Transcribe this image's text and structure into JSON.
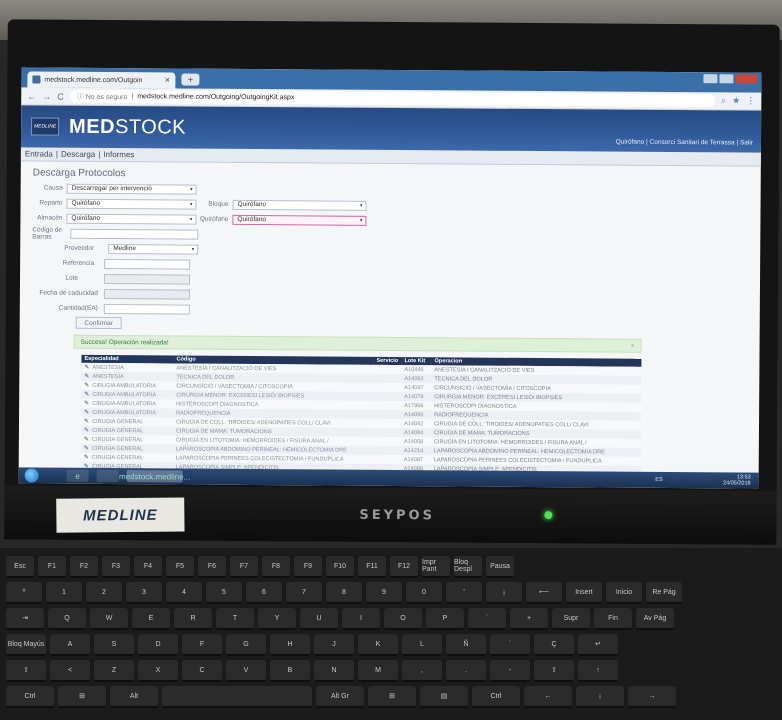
{
  "browser": {
    "tab_title": "medstock.medline.com/Outgoin",
    "tab_close": "✕",
    "new_tab": "+",
    "nav_back": "←",
    "nav_forward": "→",
    "nav_reload": "C",
    "url_warning": "ⓘ No es seguro",
    "url": "medstock.medline.com/Outgoing/OutgoingKit.aspx",
    "icon_search": "⌕",
    "icon_star": "★",
    "icon_menu": "⋮"
  },
  "app": {
    "badge": "MEDLINE",
    "title_bold": "MED",
    "title_rest": "STOCK",
    "user_info": "Quirófano | Consorci Sanitari de Terrassa | Salir"
  },
  "menu": {
    "items": [
      "Entrada",
      "Descarga",
      "Informes"
    ],
    "sep": "|"
  },
  "form": {
    "section_title": "Descarga Protocolos",
    "causa_label": "Causa",
    "causa_value": "Descarregar per intervenció",
    "reparto_label": "Reparto",
    "reparto_value": "Quirófano",
    "bloque_label": "Bloque",
    "bloque_value": "Quirófano",
    "almacen_label": "Almacén",
    "almacen_value": "Quirófano",
    "quirofano_label": "Quirófano",
    "quirofano_value": "Quirófano",
    "codigo_barras_label": "Código de Barras",
    "proveedor_label": "Proveedor",
    "proveedor_value": "Medline",
    "referencia_label": "Referencia",
    "lote_label": "Lote",
    "fecha_caducidad_label": "Fecha de caducidad",
    "cantidad_label": "Cantidad(EA)",
    "confirm_button": "Confirmar",
    "caret": "▾"
  },
  "alert": {
    "text": "Success! Operación realizada!",
    "close": "×"
  },
  "table": {
    "columns": [
      "Especialidad",
      "Código",
      "Servicio",
      "Lote Kit",
      "Operacion"
    ],
    "edit_glyph": "✎",
    "rows": [
      {
        "esp": "ANESTESIA",
        "codigo": "ANESTESIA I CANALITZACIÓ DE VIES",
        "lote": "A10446",
        "op": "ANESTESIA I CANALITZACIÓ DE VIES"
      },
      {
        "esp": "ANESTESIA",
        "codigo": "TECNICA DEL DOLOR",
        "lote": "A14062",
        "op": "TECNICA DEL DOLOR"
      },
      {
        "esp": "CIRUGIA AMBULATORIA",
        "codigo": "CIRCUNSICIÓ / VASECTOMIA / CITOSCOPIA",
        "lote": "A14097",
        "op": "CIRCUNSICIÓ / VASECTOMIA / CITOSCOPIA"
      },
      {
        "esp": "CIRUGIA AMBULATORIA",
        "codigo": "CIRURGIA MENOR: EXCERESI LESIÓ/ BIOPSIES",
        "lote": "A14079",
        "op": "CIRURGIA MENOR: EXCERESI LESIÓ/ BIOPSIES"
      },
      {
        "esp": "CIRUGIA AMBULATORIA",
        "codigo": "HISTEROSCOPI DIAGNOSTICA",
        "lote": "A17966",
        "op": "HISTEROSCOPI DIAGNOSTICA"
      },
      {
        "esp": "CIRUGIA AMBULATORIA",
        "codigo": "RADIOFREQUENCIA",
        "lote": "A14090",
        "op": "RADIOFREQUENCIA"
      },
      {
        "esp": "CIRUGIA GENERAL",
        "codigo": "CIRUGIA DE COLL: TIROIDES/ ADENOPATIES COLL/ CLAVI",
        "lote": "A14092",
        "op": "CIRUGIA DE COLL: TIROIDES/ ADENOPATIES COLL/ CLAVI"
      },
      {
        "esp": "CIRUGIA GENERAL",
        "codigo": "CIRUGIA DE MAMA: TUMORACIONS",
        "lote": "A14084",
        "op": "CIRUGIA DE MAMA: TUMORACIONS"
      },
      {
        "esp": "CIRUGIA GENERAL",
        "codigo": "CIRUGIA EN LITOTOMIA: HEMORROIDES / FISURA ANAL /",
        "lote": "A14058",
        "op": "CIRUGIA EN LITOTOMIA: HEMORROIDES / FISURA ANAL /"
      },
      {
        "esp": "CIRUGIA GENERAL",
        "codigo": "LAPAROSCOPIA ABDOMINO PERINEAL: HEMICOLECTOMIA DRE",
        "lote": "A14214",
        "op": "LAPAROSCOPIA ABDOMINO PERINEAL: HEMICOLECTOMIA DRE"
      },
      {
        "esp": "CIRUGIA GENERAL",
        "codigo": "LAPAROSCOPIA PERINEES COLECISTECTOMIA / FUNDUPLICA",
        "lote": "A14087",
        "op": "LAPAROSCOPIA PERINEES COLECISTECTOMIA / FUNDUPLICA"
      },
      {
        "esp": "CIRUGIA GENERAL",
        "codigo": "LAPAROSCOPIA SIMPLE: APENDICITIS",
        "lote": "A14088",
        "op": "LAPAROSCOPIA SIMPLE: APENDICITIS"
      }
    ]
  },
  "taskbar": {
    "lang": "ES",
    "time": "13:53",
    "date": "24/05/2018",
    "ie_glyph": "e",
    "chrome_label": "medstock.medline..."
  },
  "hardware": {
    "monitor_brand": "SEYPOS",
    "sticker": "MEDLINE"
  },
  "keyboard": {
    "fn_row": [
      "Esc",
      "F1",
      "F2",
      "F3",
      "F4",
      "F5",
      "F6",
      "F7",
      "F8",
      "F9",
      "F10",
      "F11",
      "F12",
      "Impr Pant",
      "Bloq Despl",
      "Pausa"
    ],
    "row1": [
      "º",
      "1",
      "2",
      "3",
      "4",
      "5",
      "6",
      "7",
      "8",
      "9",
      "0",
      "'",
      "¡",
      "⟵",
      "Insert",
      "Inicio",
      "Re Pág"
    ],
    "row2": [
      "⇥",
      "Q",
      "W",
      "E",
      "R",
      "T",
      "Y",
      "U",
      "I",
      "O",
      "P",
      "`",
      "+",
      "Supr",
      "Fin",
      "Av Pág"
    ],
    "row3": [
      "Bloq Mayús",
      "A",
      "S",
      "D",
      "F",
      "G",
      "H",
      "J",
      "K",
      "L",
      "Ñ",
      "´",
      "Ç",
      "↵"
    ],
    "row4": [
      "⇧",
      "<",
      "Z",
      "X",
      "C",
      "V",
      "B",
      "N",
      "M",
      ",",
      ".",
      "-",
      "⇧",
      "↑"
    ],
    "row5": [
      "Ctrl",
      "⊞",
      "Alt",
      "",
      "Alt Gr",
      "⊞",
      "▤",
      "Ctrl",
      "←",
      "↓",
      "→"
    ]
  }
}
